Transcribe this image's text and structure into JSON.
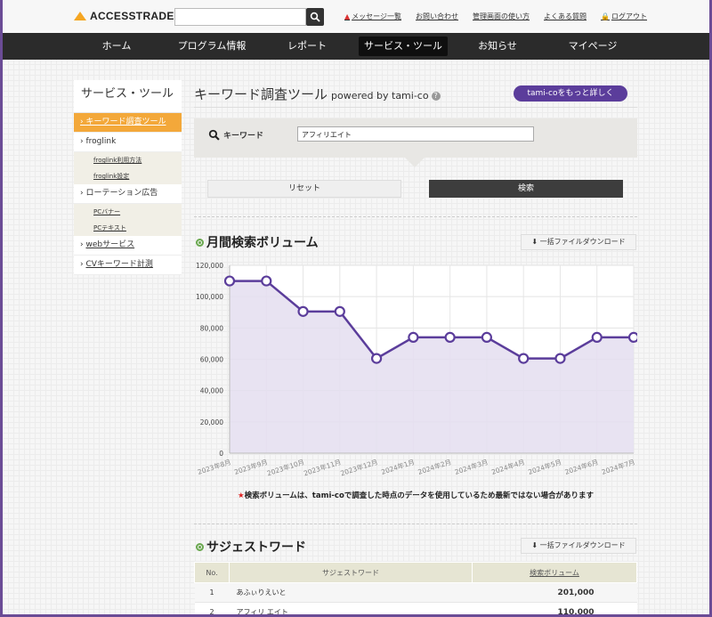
{
  "header": {
    "logo": "ACCESSTRADE",
    "search_value": "",
    "links": [
      "メッセージ一覧",
      "お問い合わせ",
      "管理画面の使い方",
      "よくある質問",
      "ログアウト"
    ]
  },
  "nav": {
    "items": [
      "ホーム",
      "プログラム情報",
      "レポート",
      "サービス・ツール",
      "お知らせ",
      "マイページ"
    ],
    "active": "サービス・ツール"
  },
  "sidebar": {
    "title": "サービス・ツール",
    "items": [
      {
        "label": "キーワード調査ツール",
        "active": true,
        "subs": []
      },
      {
        "label": "froglink",
        "subs": [
          "froglink利用方法",
          "froglink設定"
        ]
      },
      {
        "label": "ローテーション広告",
        "subs": [
          "PCバナー",
          "PCテキスト"
        ]
      },
      {
        "label": "webサービス",
        "subs": []
      },
      {
        "label": "CVキーワード計測",
        "subs": []
      }
    ]
  },
  "main": {
    "title": "キーワード調査ツール",
    "powered": "powered by tami-co",
    "more_button": "tami-coをもっと詳しく",
    "keyword_label": "キーワード",
    "keyword_value": "アフィリエイト",
    "reset_button": "リセット",
    "search_button": "検索",
    "monthly_title": "月間検索ボリューム",
    "download_button": "一括ファイルダウンロード",
    "note": "検索ボリュームは、tami-coで調査した時点のデータを使用しているため最新ではない場合があります",
    "note_mark": "★",
    "suggest_title": "サジェストワード",
    "suggest_download": "一括ファイルダウンロード"
  },
  "chart_data": {
    "type": "area",
    "categories": [
      "2023年8月",
      "2023年9月",
      "2023年10月",
      "2023年11月",
      "2023年12月",
      "2024年1月",
      "2024年2月",
      "2024年3月",
      "2024年4月",
      "2024年5月",
      "2024年6月",
      "2024年7月"
    ],
    "values": [
      110000,
      110000,
      90500,
      90500,
      60500,
      74000,
      74000,
      74000,
      60500,
      60500,
      74000,
      74000
    ],
    "ylim": [
      0,
      120000
    ],
    "yticks": [
      "0",
      "20,000",
      "40,000",
      "60,000",
      "80,000",
      "100,000",
      "120,000"
    ],
    "grid": true,
    "colors": {
      "line": "#5b3d9b",
      "fill": "#e4def0"
    }
  },
  "suggest_table": {
    "headers": [
      "No.",
      "サジェストワード",
      "検索ボリューム"
    ],
    "rows": [
      {
        "no": "1",
        "word": "あふぃりえいと",
        "volume": "201,000"
      },
      {
        "no": "2",
        "word": "アフィリ エイト",
        "volume": "110,000"
      }
    ]
  }
}
